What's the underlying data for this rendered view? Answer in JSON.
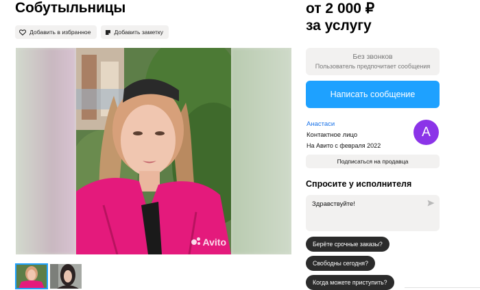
{
  "listing": {
    "title": "Собутыльницы",
    "favorite_label": "Добавить в избранное",
    "note_label": "Добавить заметку",
    "price_line1": "от 2 000 ₽",
    "price_line2": "за услугу",
    "watermark": "Avito"
  },
  "contact": {
    "no_calls_title": "Без звонков",
    "no_calls_subtitle": "Пользователь предпочитает сообщения",
    "write_button": "Написать сообщение"
  },
  "seller": {
    "name": "Анастаси",
    "role": "Контактное лицо",
    "since": "На Авито с февраля 2022",
    "avatar_letter": "А",
    "avatar_color": "#8b34e8",
    "subscribe_label": "Подписаться на продавца"
  },
  "ask": {
    "title": "Спросите у исполнителя",
    "message": "Здравствуйте!",
    "chips": [
      "Берёте срочные заказы?",
      "Свободны сегодня?",
      "Когда можете приступить?"
    ]
  },
  "colors": {
    "accent": "#1ea1ff",
    "chip_bg": "#2b2b2b",
    "surface": "#f2f1f0"
  }
}
